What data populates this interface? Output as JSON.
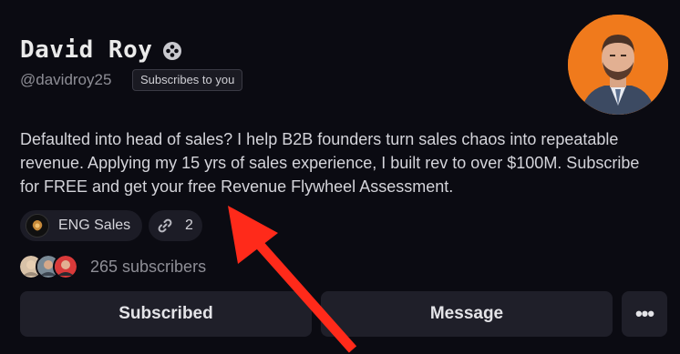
{
  "profile": {
    "name": "David Roy",
    "handle": "@davidroy25",
    "relationship_badge": "Subscribes to you",
    "bio": "Defaulted into head of sales? I help B2B founders turn sales chaos into repeatable revenue. Applying my 15 yrs of sales experience, I built rev to over $100M. Subscribe for FREE and get your free Revenue Flywheel Assessment.",
    "avatar_background": "#f07a1c",
    "verified_icon": "verified-badge-icon"
  },
  "publication": {
    "label": "ENG Sales",
    "icon": "publication-logo-icon"
  },
  "links": {
    "count": "2",
    "icon": "link-icon"
  },
  "subscribers": {
    "text": "265 subscribers"
  },
  "actions": {
    "subscribed_label": "Subscribed",
    "message_label": "Message",
    "more_label": "•••"
  },
  "annotation": {
    "arrow_color": "#ff2a1a"
  }
}
